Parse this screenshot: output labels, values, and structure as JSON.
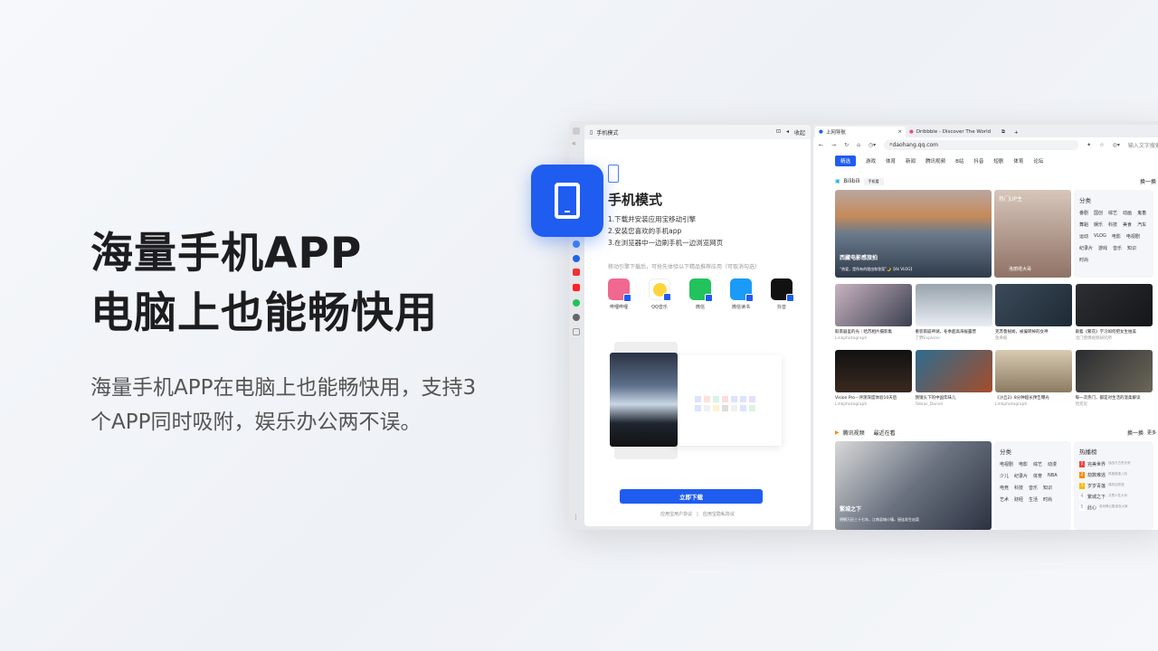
{
  "hero": {
    "title_line1": "海量手机APP",
    "title_line2": "电脑上也能畅快用",
    "description": "海量手机APP在电脑上也能畅快用，支持3个APP同时吸附，娱乐办公两不误。"
  },
  "phone_panel": {
    "header_title": "手机模式",
    "collapse_label": "收起",
    "title": "手机模式",
    "steps": [
      "1.下载并安装应用宝移动引擎",
      "2.安装您喜欢的手机app",
      "3.在浏览器中一边刷手机一边浏览网页"
    ],
    "hint": "移动引擎下载后，可抢先体验以下精品推荐应用（可取消勾选）",
    "apps": [
      {
        "name": "哔哩哔哩",
        "color": "#f0688f"
      },
      {
        "name": "QQ音乐",
        "color": "#ffd43a"
      },
      {
        "name": "微信",
        "color": "#22c35d"
      },
      {
        "name": "微信读书",
        "color": "#1a9bf7"
      },
      {
        "name": "抖音",
        "color": "#111111"
      }
    ],
    "download_button": "立即下载",
    "user_agreement": "应用宝用户协议",
    "separator": "|",
    "privacy_agreement": "应用宝隐私协议"
  },
  "browser": {
    "tabs": [
      {
        "title": "上网导航",
        "active": true
      },
      {
        "title": "Dribbble - Discover The World",
        "active": false
      }
    ],
    "url": "daohang.qq.com",
    "search_placeholder": "输入文字搜索",
    "nav": [
      "精选",
      "游戏",
      "体育",
      "新闻",
      "腾讯视频",
      "B站",
      "抖音",
      "短剧",
      "体育",
      "论坛"
    ],
    "bili": {
      "name": "Bilibili",
      "phone_label": "手机看",
      "refresh": "换一换",
      "banner_title": "西藏电影感旅拍",
      "banner_sub": "“热爱，是所有的理由和答案”🌙【4k VLOG】",
      "up": {
        "title": "热门UP主",
        "name": "洛丽塔大哥"
      },
      "categories_title": "分类",
      "categories": [
        "番剧",
        "国创",
        "综艺",
        "动画",
        "鬼畜",
        "舞蹈",
        "娱乐",
        "科技",
        "美食",
        "汽车",
        "运动",
        "VLOG",
        "电影",
        "电视剧",
        "纪录片",
        "游戏",
        "音乐",
        "知识",
        "时尚"
      ],
      "videos": [
        {
          "title": "取景器里的光｜哈苏相片摄影集",
          "author": "Linkphotograph"
        },
        {
          "title": "重装雨崩神湖，冬季超高海拔露营",
          "author": "丁野Explorer"
        },
        {
          "title": "克苏鲁秘闻，被偏转掉的女神",
          "author": "鱼骨殿"
        },
        {
          "title": "跟着《繁花》学习如何把女生拍美",
          "author": "北门使偶视频研究所"
        },
        {
          "title": "Vision Pro－评测深度体验10天后",
          "author": "Linkphotograph"
        },
        {
          "title": "我镜头下的中国年味儿",
          "author": "Tobias_Daniel"
        },
        {
          "title": "《沙丘2》8分钟超长预告曝光",
          "author": "Linkphotograph"
        },
        {
          "title": "每一次热门，都是对生活的温柔解读",
          "author": "哈克尼"
        }
      ]
    },
    "tencent": {
      "name": "腾讯视频",
      "recent": "最近在看",
      "refresh": "换一换",
      "more": "更多",
      "banner_title": "繁城之下",
      "banner_sub": "明朝万历三十七年，江南县城小镇，接连发生凶案",
      "categories_title": "分类",
      "categories": [
        "电视剧",
        "电影",
        "综艺",
        "动漫",
        "少儿",
        "纪录片",
        "体育",
        "NBA",
        "电竞",
        "科技",
        "音乐",
        "知识",
        "艺术",
        "财经",
        "生活",
        "时尚"
      ],
      "hot_title": "热播榜",
      "hot": [
        {
          "rank": "1",
          "title": "完美世界",
          "desc": "独战万古荒天帝"
        },
        {
          "rank": "2",
          "title": "劫数难逃",
          "desc": "再度被重入险"
        },
        {
          "rank": "3",
          "title": "岁岁青莲",
          "desc": "偶然巨肢搜"
        },
        {
          "rank": "4",
          "title": "繁城之下",
          "desc": "共贯人性大戏"
        },
        {
          "rank": "5",
          "title": "此心",
          "desc": "老戏骨云集追查大案"
        }
      ]
    }
  },
  "colors": {
    "accent": "#1f5cf0",
    "frame": "#e6e7eb"
  }
}
